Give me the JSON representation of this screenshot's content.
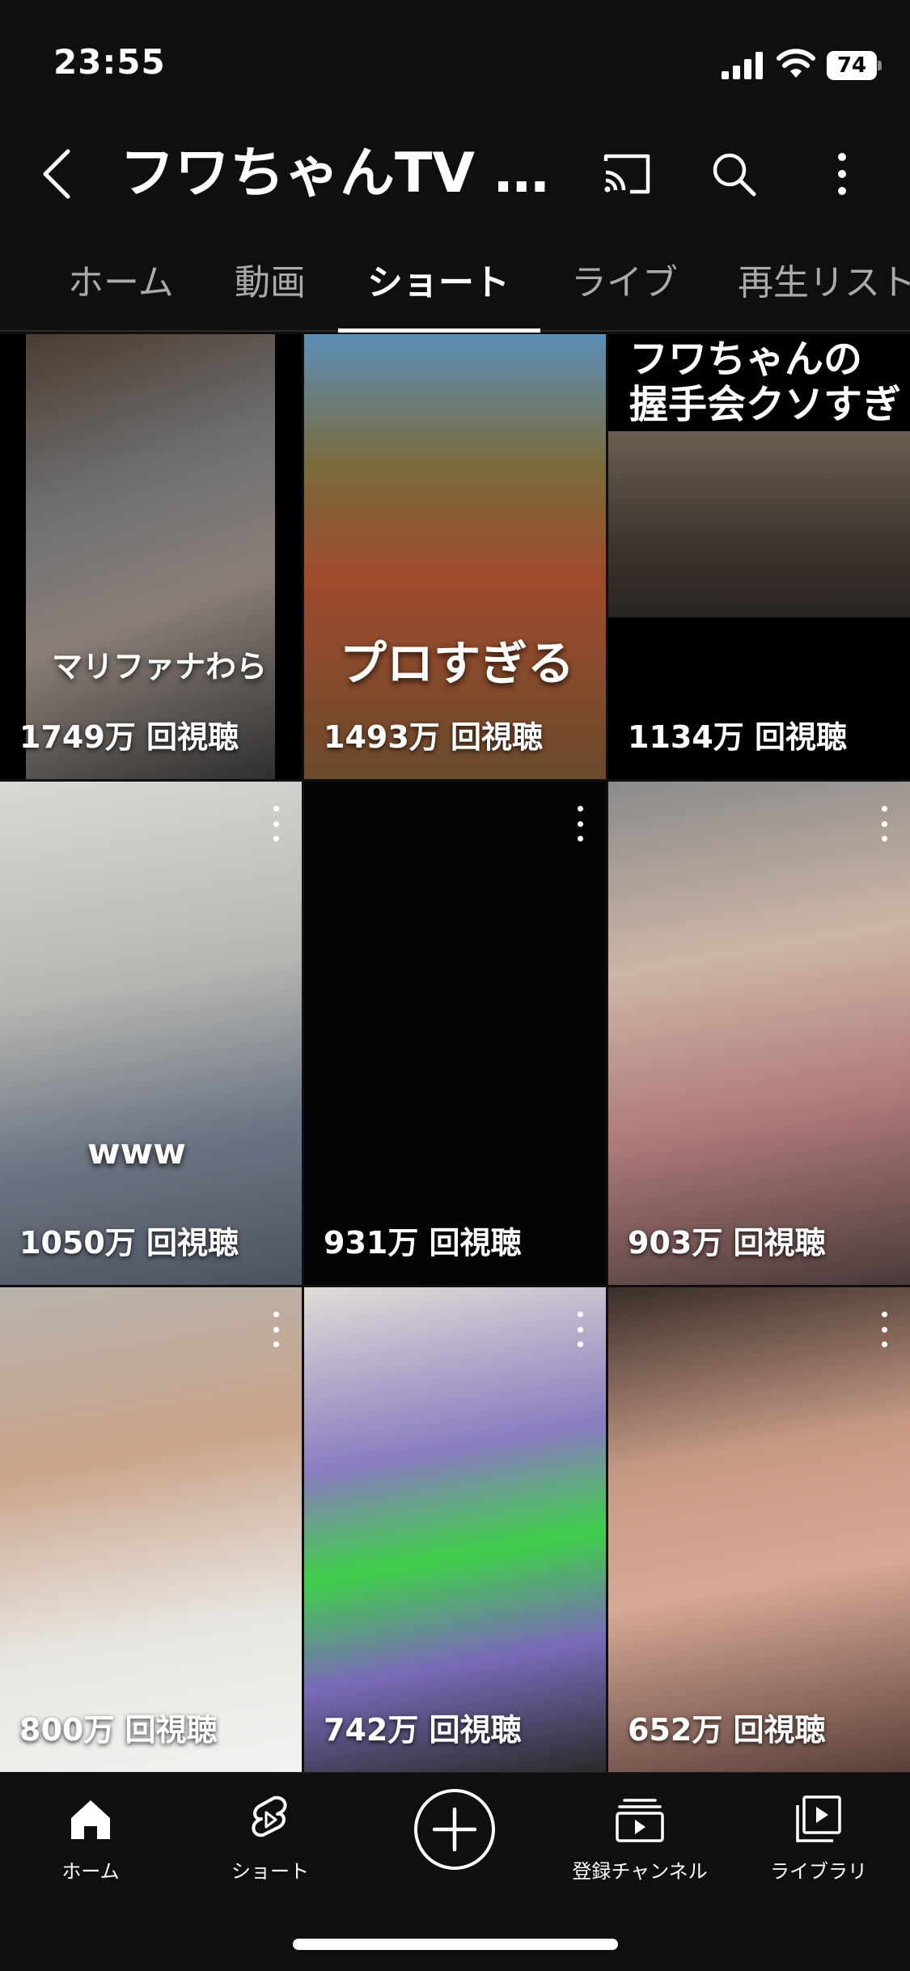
{
  "status": {
    "time": "23:55",
    "battery": "74"
  },
  "header": {
    "title": "フワちゃんTV /フワちゃんTV",
    "icons": [
      "back-icon",
      "cast-icon",
      "search-icon",
      "more-vert-icon"
    ]
  },
  "tabs": [
    {
      "label": "ホーム"
    },
    {
      "label": "動画"
    },
    {
      "label": "ショート",
      "active": true
    },
    {
      "label": "ライブ"
    },
    {
      "label": "再生リスト"
    }
  ],
  "shorts": [
    {
      "views": "1749万 回視聴",
      "caption": "マリファナわら"
    },
    {
      "views": "1493万 回視聴",
      "caption": "プロすぎる"
    },
    {
      "views": "1134万 回視聴",
      "caption_line1": "フワちゃんの",
      "caption_line2": "握手会クソすぎ"
    },
    {
      "views": "1050万 回視聴",
      "caption": "www"
    },
    {
      "views": "931万 回視聴"
    },
    {
      "views": "903万 回視聴"
    },
    {
      "views": "800万 回視聴"
    },
    {
      "views": "742万 回視聴"
    },
    {
      "views": "652万 回視聴"
    }
  ],
  "bottom_nav": {
    "home": "ホーム",
    "shorts": "ショート",
    "subscriptions": "登録チャンネル",
    "library": "ライブラリ"
  },
  "colors": {
    "background": "#0f0f0f",
    "text": "#ffffff",
    "inactive_tab": "#aaaaaa"
  }
}
